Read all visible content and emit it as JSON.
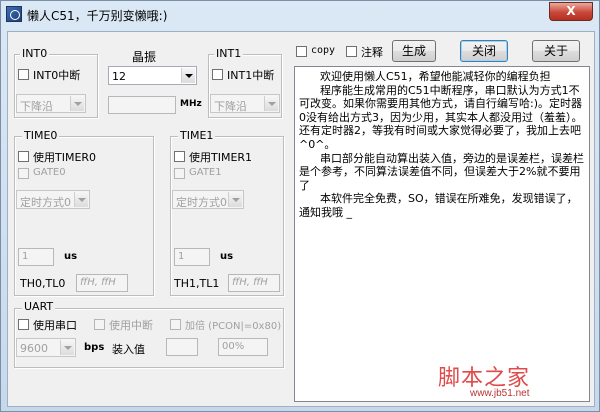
{
  "window": {
    "title": "懒人C51，千万别变懒哦:)",
    "close_label": "X"
  },
  "int0": {
    "legend": "INT0",
    "checkbox_label": "INT0中断",
    "mode_value": "下降沿"
  },
  "int1": {
    "legend": "INT1",
    "checkbox_label": "INT1中断",
    "mode_value": "下降沿"
  },
  "crystal": {
    "label": "晶振",
    "value": "12",
    "unit": "MHz",
    "readout": ""
  },
  "toolbar": {
    "copy_label": "copy",
    "comment_label": "注释",
    "generate_label": "生成",
    "close_label": "关闭",
    "about_label": "关于"
  },
  "timer0": {
    "legend": "TIME0",
    "use_label": "使用TIMER0",
    "gate_label": "GATE0",
    "mode_value": "定时方式0",
    "time_value": "1",
    "time_unit": "us",
    "reg_label": "TH0,TL0",
    "reg_value": "ffH, ffH"
  },
  "timer1": {
    "legend": "TIME1",
    "use_label": "使用TIMER1",
    "gate_label": "GATE1",
    "mode_value": "定时方式0",
    "time_value": "1",
    "time_unit": "us",
    "reg_label": "TH1,TL1",
    "reg_value": "ffH, ffH"
  },
  "uart": {
    "legend": "UART",
    "use_label": "使用串口",
    "interrupt_label": "使用中断",
    "double_label": "加倍 (PCON|=0x80)",
    "baud_value": "9600",
    "baud_unit": "bps",
    "load_label": "装入值",
    "load_value": "",
    "error_value": "00%"
  },
  "memo": {
    "text": "      欢迎使用懒人C51，希望他能减轻你的编程负担\n      程序能生成常用的C51中断程序，串口默认为方式1不可改变。如果你需要用其他方式，请自行编写哈:)。定时器0没有给出方式3，因为少用，其实本人都没用过（羞羞）。还有定时器2，等我有时间或大家觉得必要了，我加上去吧^0^。\n      串口部分能自动算出装入值，旁边的是误差栏，误差栏是个参考，不同算法误差值不同，但误差大于2%就不要用了\n      本软件完全免费，SO，错误在所难免，发现错误了，通知我哦 _"
  },
  "watermark": {
    "main": "脚本之家",
    "url": "www.jb51.net"
  }
}
